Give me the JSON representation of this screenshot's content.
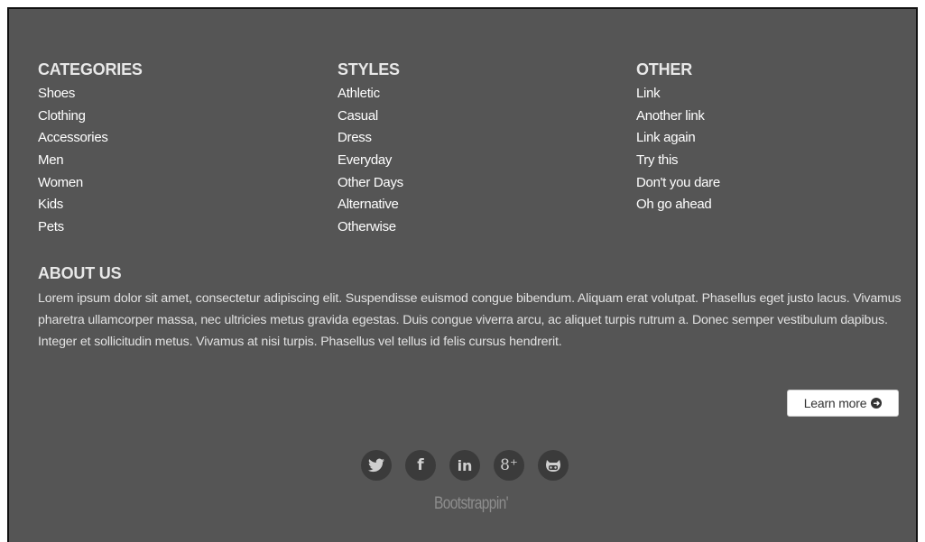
{
  "footer": {
    "columns": [
      {
        "title": "CATEGORIES",
        "links": [
          "Shoes",
          "Clothing",
          "Accessories",
          "Men",
          "Women",
          "Kids",
          "Pets"
        ]
      },
      {
        "title": "STYLES",
        "links": [
          "Athletic",
          "Casual",
          "Dress",
          "Everyday",
          "Other Days",
          "Alternative",
          "Otherwise"
        ]
      },
      {
        "title": "OTHER",
        "links": [
          "Link",
          "Another link",
          "Link again",
          "Try this",
          "Don't you dare",
          "Oh go ahead"
        ]
      }
    ],
    "about": {
      "title": "ABOUT US",
      "text": "Lorem ipsum dolor sit amet, consectetur adipiscing elit. Suspendisse euismod congue bibendum. Aliquam erat volutpat. Phasellus eget justo lacus. Vivamus pharetra ullamcorper massa, nec ultricies metus gravida egestas. Duis congue viverra arcu, ac aliquet turpis rutrum a. Donec semper vestibulum dapibus. Integer et sollicitudin metus. Vivamus at nisi turpis. Phasellus vel tellus id felis cursus hendrerit.",
      "button_label": "Learn more"
    },
    "social": [
      {
        "icon": "twitter-icon",
        "glyph": "🐦"
      },
      {
        "icon": "facebook-icon",
        "glyph": "f"
      },
      {
        "icon": "linkedin-icon",
        "glyph": "in"
      },
      {
        "icon": "google-plus-icon",
        "glyph": "8⁺"
      },
      {
        "icon": "github-icon",
        "glyph": "🐱"
      }
    ],
    "brand": "Bootstrappin'"
  },
  "colors": {
    "background": "#555555",
    "heading": "#e8e8e8",
    "link": "#ffffff",
    "social_circle": "#3b3b3b",
    "brand_text": "#8d8d8d"
  }
}
